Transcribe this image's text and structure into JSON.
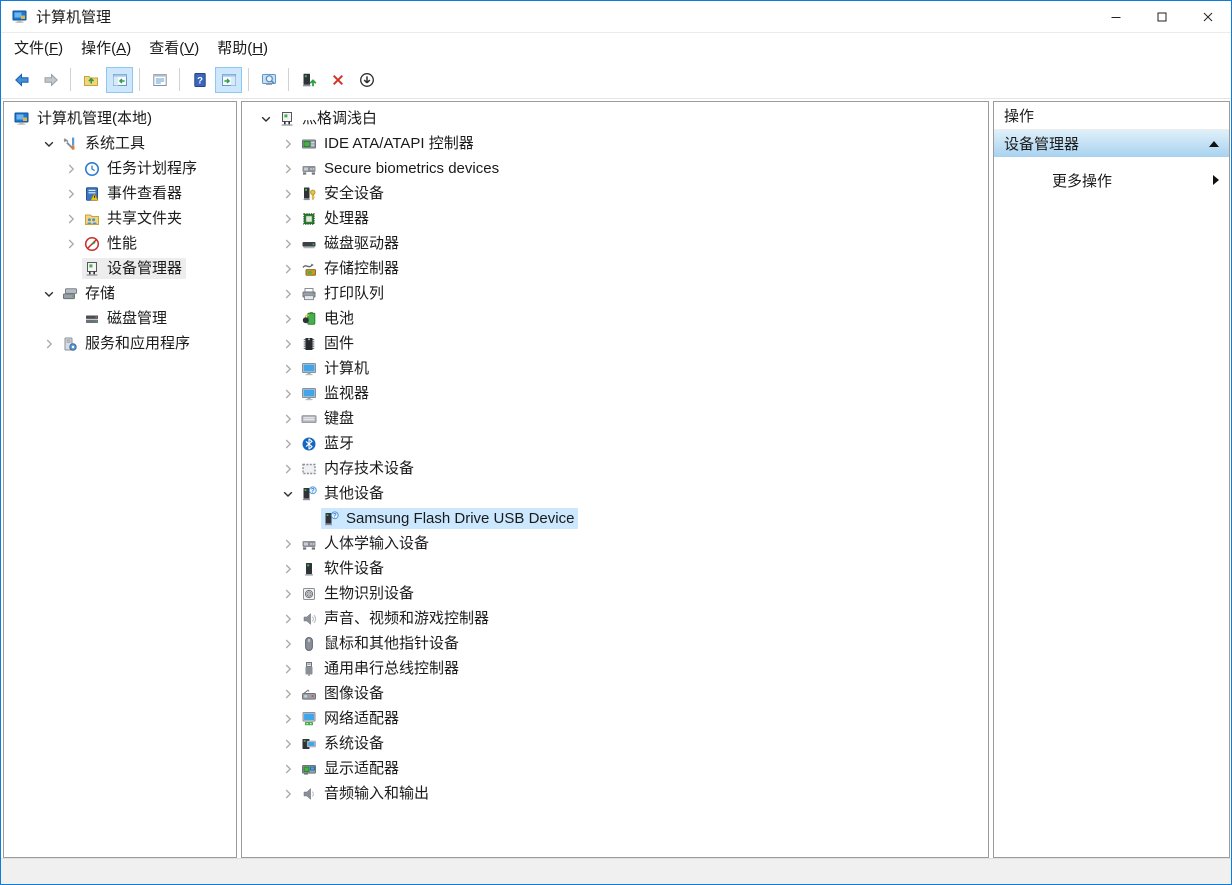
{
  "window": {
    "title": "计算机管理"
  },
  "window_controls": [
    {
      "name": "minimize",
      "icon": "minimize-icon"
    },
    {
      "name": "maximize",
      "icon": "maximize-icon"
    },
    {
      "name": "close",
      "icon": "close-icon"
    }
  ],
  "menu_bar": {
    "items": [
      {
        "pre": "文件(",
        "key": "F",
        "post": ")"
      },
      {
        "pre": "操作(",
        "key": "A",
        "post": ")"
      },
      {
        "pre": "查看(",
        "key": "V",
        "post": ")"
      },
      {
        "pre": "帮助(",
        "key": "H",
        "post": ")"
      }
    ]
  },
  "toolbar": {
    "buttons": [
      {
        "type": "button",
        "name": "back",
        "icon": "back-arrow-icon",
        "toggled": false
      },
      {
        "type": "button",
        "name": "forward",
        "icon": "forward-arrow-icon",
        "toggled": false
      },
      {
        "type": "separator"
      },
      {
        "type": "button",
        "name": "up-one-level",
        "icon": "up-one-level-icon",
        "toggled": false
      },
      {
        "type": "button",
        "name": "show-hide-console-tree",
        "icon": "console-tree-toggle-icon",
        "toggled": true
      },
      {
        "type": "separator"
      },
      {
        "type": "button",
        "name": "properties",
        "icon": "properties-icon",
        "toggled": false
      },
      {
        "type": "separator"
      },
      {
        "type": "button",
        "name": "help",
        "icon": "help-icon",
        "toggled": false
      },
      {
        "type": "button",
        "name": "show-hide-action-pane",
        "icon": "action-pane-toggle-icon",
        "toggled": true
      },
      {
        "type": "separator"
      },
      {
        "type": "button",
        "name": "scan-for-hardware-changes",
        "icon": "scan-hardware-icon",
        "toggled": false
      },
      {
        "type": "separator"
      },
      {
        "type": "button",
        "name": "update-driver",
        "icon": "update-driver-icon",
        "toggled": false
      },
      {
        "type": "button",
        "name": "uninstall-device",
        "icon": "uninstall-device-icon",
        "toggled": false
      },
      {
        "type": "button",
        "name": "disable-device",
        "icon": "disable-device-icon",
        "toggled": false
      }
    ]
  },
  "console_tree": {
    "items": [
      {
        "depth": 0,
        "expander": null,
        "icon": "computer-management-icon",
        "label": "计算机管理(本地)",
        "selected": null
      },
      {
        "depth": 1,
        "expander": "expanded",
        "icon": "system-tools-icon",
        "label": "系统工具",
        "selected": null
      },
      {
        "depth": 2,
        "expander": "collapsed",
        "icon": "task-scheduler-icon",
        "label": "任务计划程序",
        "selected": null
      },
      {
        "depth": 2,
        "expander": "collapsed",
        "icon": "event-viewer-icon",
        "label": "事件查看器",
        "selected": null
      },
      {
        "depth": 2,
        "expander": "collapsed",
        "icon": "shared-folders-icon",
        "label": "共享文件夹",
        "selected": null
      },
      {
        "depth": 2,
        "expander": "collapsed",
        "icon": "performance-icon",
        "label": "性能",
        "selected": null
      },
      {
        "depth": 2,
        "expander": null,
        "icon": "device-manager-icon",
        "label": "设备管理器",
        "selected": "inactive"
      },
      {
        "depth": 1,
        "expander": "expanded",
        "icon": "storage-icon",
        "label": "存储",
        "selected": null
      },
      {
        "depth": 2,
        "expander": null,
        "icon": "disk-management-icon",
        "label": "磁盘管理",
        "selected": null
      },
      {
        "depth": 1,
        "expander": "collapsed",
        "icon": "services-icon",
        "label": "服务和应用程序",
        "selected": null
      }
    ]
  },
  "device_tree": {
    "items": [
      {
        "depth": 0,
        "expander": "expanded",
        "icon": "computer-icon",
        "label": "灬格调浅白",
        "selected": null
      },
      {
        "depth": 1,
        "expander": "collapsed",
        "icon": "ide-controller-icon",
        "label": "IDE ATA/ATAPI 控制器",
        "selected": null
      },
      {
        "depth": 1,
        "expander": "collapsed",
        "icon": "hid-device-icon",
        "label": "Secure biometrics devices",
        "selected": null
      },
      {
        "depth": 1,
        "expander": "collapsed",
        "icon": "security-device-icon",
        "label": "安全设备",
        "selected": null
      },
      {
        "depth": 1,
        "expander": "collapsed",
        "icon": "processor-icon",
        "label": "处理器",
        "selected": null
      },
      {
        "depth": 1,
        "expander": "collapsed",
        "icon": "disk-drive-icon",
        "label": "磁盘驱动器",
        "selected": null
      },
      {
        "depth": 1,
        "expander": "collapsed",
        "icon": "storage-controller-icon",
        "label": "存储控制器",
        "selected": null
      },
      {
        "depth": 1,
        "expander": "collapsed",
        "icon": "print-queue-icon",
        "label": "打印队列",
        "selected": null
      },
      {
        "depth": 1,
        "expander": "collapsed",
        "icon": "battery-icon",
        "label": "电池",
        "selected": null
      },
      {
        "depth": 1,
        "expander": "collapsed",
        "icon": "firmware-icon",
        "label": "固件",
        "selected": null
      },
      {
        "depth": 1,
        "expander": "collapsed",
        "icon": "computer-monitor-icon",
        "label": "计算机",
        "selected": null
      },
      {
        "depth": 1,
        "expander": "collapsed",
        "icon": "monitor-icon",
        "label": "监视器",
        "selected": null
      },
      {
        "depth": 1,
        "expander": "collapsed",
        "icon": "keyboard-icon",
        "label": "键盘",
        "selected": null
      },
      {
        "depth": 1,
        "expander": "collapsed",
        "icon": "bluetooth-icon",
        "label": "蓝牙",
        "selected": null
      },
      {
        "depth": 1,
        "expander": "collapsed",
        "icon": "memory-tech-icon",
        "label": "内存技术设备",
        "selected": null
      },
      {
        "depth": 1,
        "expander": "expanded",
        "icon": "unknown-device-icon",
        "label": "其他设备",
        "selected": null
      },
      {
        "depth": 2,
        "expander": null,
        "icon": "unknown-device-icon",
        "label": "Samsung Flash Drive USB Device",
        "selected": "active"
      },
      {
        "depth": 1,
        "expander": "collapsed",
        "icon": "hid-device-icon",
        "label": "人体学输入设备",
        "selected": null
      },
      {
        "depth": 1,
        "expander": "collapsed",
        "icon": "software-device-icon",
        "label": "软件设备",
        "selected": null
      },
      {
        "depth": 1,
        "expander": "collapsed",
        "icon": "biometric-icon",
        "label": "生物识别设备",
        "selected": null
      },
      {
        "depth": 1,
        "expander": "collapsed",
        "icon": "audio-controller-icon",
        "label": "声音、视频和游戏控制器",
        "selected": null
      },
      {
        "depth": 1,
        "expander": "collapsed",
        "icon": "mouse-icon",
        "label": "鼠标和其他指针设备",
        "selected": null
      },
      {
        "depth": 1,
        "expander": "collapsed",
        "icon": "usb-controller-icon",
        "label": "通用串行总线控制器",
        "selected": null
      },
      {
        "depth": 1,
        "expander": "collapsed",
        "icon": "imaging-device-icon",
        "label": "图像设备",
        "selected": null
      },
      {
        "depth": 1,
        "expander": "collapsed",
        "icon": "network-adapter-icon",
        "label": "网络适配器",
        "selected": null
      },
      {
        "depth": 1,
        "expander": "collapsed",
        "icon": "system-devices-icon",
        "label": "系统设备",
        "selected": null
      },
      {
        "depth": 1,
        "expander": "collapsed",
        "icon": "display-adapter-icon",
        "label": "显示适配器",
        "selected": null
      },
      {
        "depth": 1,
        "expander": "collapsed",
        "icon": "audio-io-icon",
        "label": "音频输入和输出",
        "selected": null
      }
    ]
  },
  "action_pane": {
    "title": "操作",
    "section_title": "设备管理器",
    "section_collapsed": false,
    "more_actions_label": "更多操作"
  },
  "colors": {
    "accent_border": "#0f7cd6",
    "selection_active_bg": "#cce8ff",
    "selection_inactive_bg": "#ededed",
    "action_section_gradient_top": "#dff0fa",
    "action_section_gradient_bottom": "#a8d2ef"
  }
}
